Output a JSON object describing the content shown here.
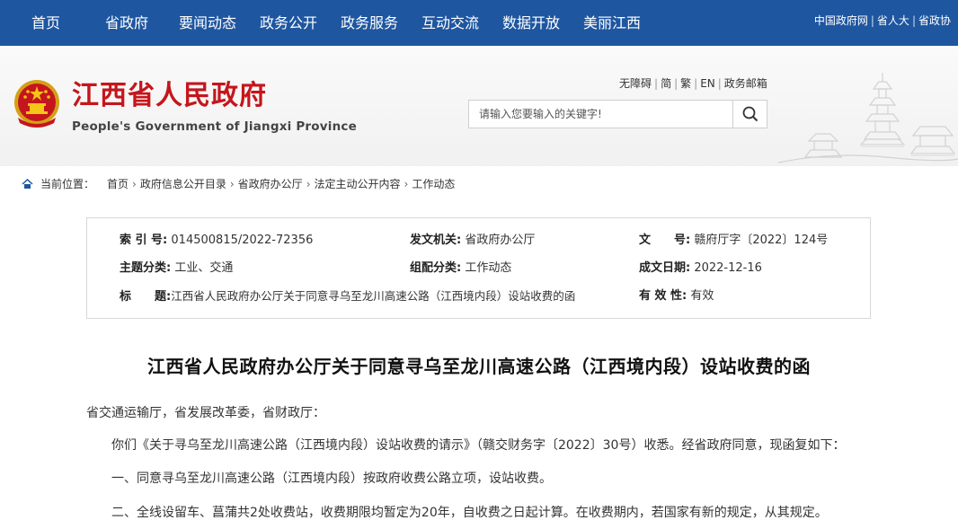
{
  "nav": {
    "items": [
      "首页",
      "省政府",
      "要闻动态",
      "政务公开",
      "政务服务",
      "互动交流",
      "数据开放",
      "美丽江西"
    ],
    "links": [
      "中国政府网",
      "省人大",
      "省政协"
    ]
  },
  "header": {
    "title": "江西省人民政府",
    "subtitle": "People's Government of Jiangxi Province",
    "utility": [
      "无障碍",
      "简",
      "繁",
      "EN",
      "政务邮箱"
    ],
    "search_placeholder": "请输入您要输入的关键字!"
  },
  "breadcrumb": {
    "label": "当前位置：",
    "items": [
      "首页",
      "政府信息公开目录",
      "省政府办公厅",
      "法定主动公开内容",
      "工作动态"
    ]
  },
  "meta": {
    "index_label": "索 引 号:",
    "index_value": "014500815/2022-72356",
    "issuer_label": "发文机关:",
    "issuer_value": "省政府办公厅",
    "docno_label": "文　　号:",
    "docno_value": "赣府厅字〔2022〕124号",
    "topic_label": "主题分类:",
    "topic_value": "工业、交通",
    "group_label": "组配分类:",
    "group_value": "工作动态",
    "date_label": "成文日期:",
    "date_value": "2022-12-16",
    "title_label": "标　　题:",
    "title_value": "江西省人民政府办公厅关于同意寻乌至龙川高速公路（江西境内段）设站收费的函",
    "validity_label": "有 效 性:",
    "validity_value": "有效"
  },
  "article": {
    "title": "江西省人民政府办公厅关于同意寻乌至龙川高速公路（江西境内段）设站收费的函",
    "recipient": "省交通运输厅，省发展改革委，省财政厅：",
    "paragraphs": [
      "你们《关于寻乌至龙川高速公路（江西境内段）设站收费的请示》（赣交财务字〔2022〕30号）收悉。经省政府同意，现函复如下：",
      "一、同意寻乌至龙川高速公路（江西境内段）按政府收费公路立项，设站收费。",
      "二、全线设留车、菖蒲共2处收费站，收费期限均暂定为20年，自收费之日起计算。在收费期内，若国家有新的规定，从其规定。"
    ]
  },
  "colors": {
    "nav_bg": "#1e56a0",
    "title_red": "#c4161c"
  }
}
